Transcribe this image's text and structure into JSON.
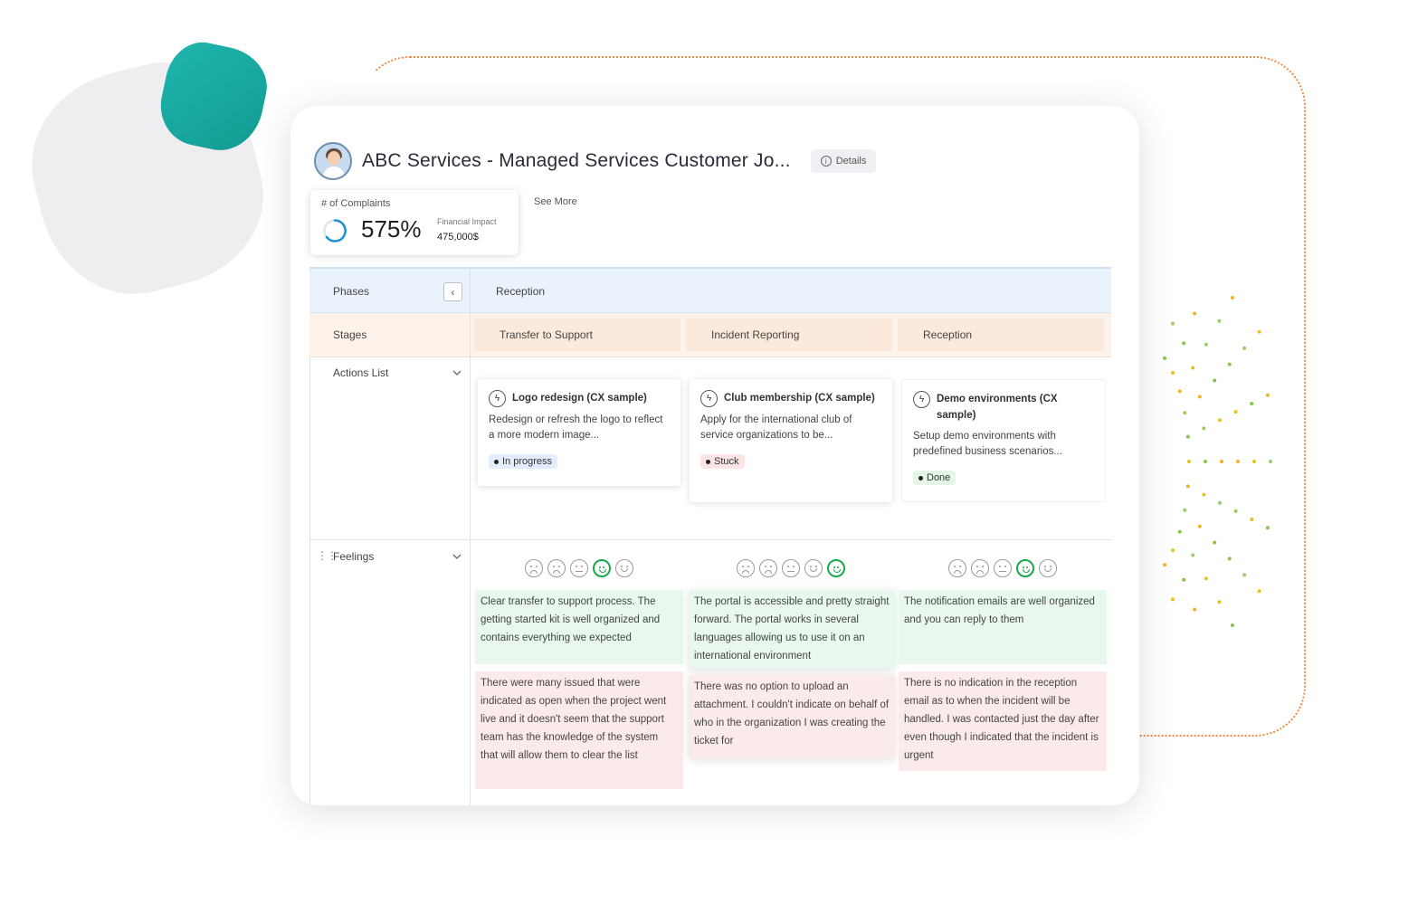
{
  "header": {
    "title": "ABC Services - Managed Services Customer Jo...",
    "details_label": "Details"
  },
  "kpi": {
    "label": "# of Complaints",
    "value": "575%",
    "sub_label": "Financial Impact",
    "sub_value": "475,000$"
  },
  "see_more": "See More",
  "grid": {
    "phases_label": "Phases",
    "phase_name": "Reception",
    "stages_label": "Stages",
    "stages": [
      "Transfer to Support",
      "Incident Reporting",
      "Reception"
    ],
    "actions_label": "Actions List",
    "feelings_label": "Feelings"
  },
  "actions": [
    {
      "title": "Logo redesign (CX sample)",
      "desc": "Redesign or refresh the logo to reflect a more modern image...",
      "status": "In progress"
    },
    {
      "title": "Club membership (CX sample)",
      "desc": "Apply for the international club of service organizations to be...",
      "status": "Stuck"
    },
    {
      "title": "Demo environments (CX sample)",
      "desc": "Setup demo environments with predefined business scenarios...",
      "status": "Done"
    }
  ],
  "feelings": [
    {
      "selected_rating": 4,
      "positive": "Clear transfer to support process. The getting started kit is well organized and contains everything we expected",
      "negative": "There were many issued that were indicated as open when the project went live and it doesn't seem that the support team has the knowledge of the system that will allow them to clear the list"
    },
    {
      "selected_rating": 5,
      "positive": "The portal is accessible and pretty straight forward. The portal works in several languages allowing us to use it on an international environment",
      "negative": "There was no option to upload an attachment. I couldn't indicate on behalf of who in the organization I was creating the ticket for"
    },
    {
      "selected_rating": 4,
      "positive": "The notification emails are well organized and you can reply to them",
      "negative": "There is no indication in the reception email as to when the incident will be handled. I was contacted just the day after even though I indicated that the incident is urgent"
    }
  ],
  "colors": {
    "accent_teal": "#1aa89f",
    "dotted_border": "#f08a45",
    "rating_active": "#1aa84a",
    "phase_row_bg": "#eaf3fc",
    "stage_row_bg": "#fdf3ea",
    "positive_bg": "#e9f8ec",
    "negative_bg": "#fbeaea"
  },
  "icons": {
    "info": "info-icon",
    "collapse": "chevron-left-icon",
    "expand": "chevron-down-icon",
    "action": "bolt-icon",
    "drag": "drag-handle-icon",
    "rating_faces": [
      "very-sad-face-icon",
      "sad-face-icon",
      "neutral-face-icon",
      "happy-face-icon",
      "very-happy-face-icon"
    ]
  }
}
